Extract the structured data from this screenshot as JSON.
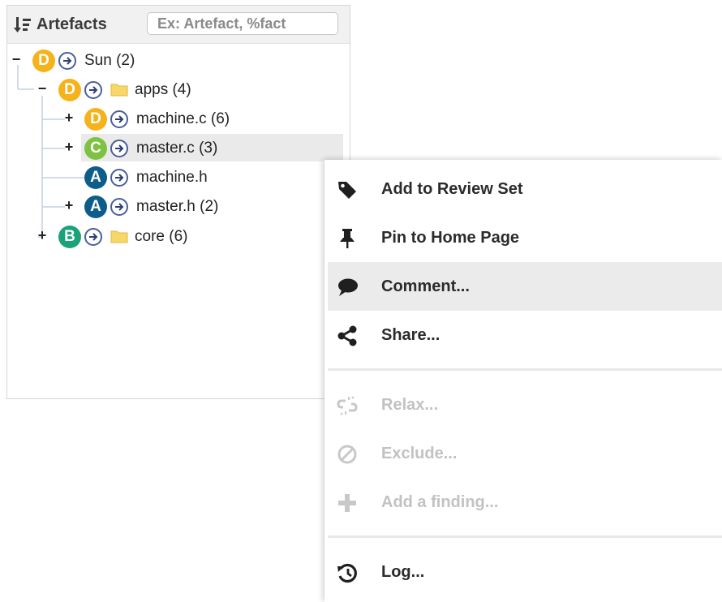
{
  "panel": {
    "title": "Artefacts",
    "sort_icon": "sort-descending-icon",
    "search": {
      "placeholder": "Ex: Artefact, %fact",
      "value": ""
    }
  },
  "tree": [
    {
      "label": "Sun (2)",
      "grade": "D",
      "toggle": "−",
      "folder": false
    },
    {
      "label": "apps (4)",
      "grade": "D",
      "toggle": "−",
      "folder": true
    },
    {
      "label": "machine.c (6)",
      "grade": "D",
      "toggle": "+",
      "folder": false
    },
    {
      "label": "master.c (3)",
      "grade": "C",
      "toggle": "+",
      "folder": false,
      "selected": true
    },
    {
      "label": "machine.h",
      "grade": "A",
      "toggle": "",
      "folder": false
    },
    {
      "label": "master.h (2)",
      "grade": "A",
      "toggle": "+",
      "folder": false
    },
    {
      "label": "core (6)",
      "grade": "B",
      "toggle": "+",
      "folder": true
    }
  ],
  "grade_colors": {
    "A": "#0d5d8a",
    "B": "#1aa37a",
    "C": "#7ec242",
    "D": "#f6b21b"
  },
  "context_menu": {
    "items": [
      {
        "label": "Add to Review Set",
        "icon": "tag-icon",
        "enabled": true
      },
      {
        "label": "Pin to Home Page",
        "icon": "pin-icon",
        "enabled": true
      },
      {
        "label": "Comment...",
        "icon": "comment-icon",
        "enabled": true,
        "hovered": true
      },
      {
        "label": "Share...",
        "icon": "share-icon",
        "enabled": true
      },
      {
        "label": "Relax...",
        "icon": "broken-link-icon",
        "enabled": false
      },
      {
        "label": "Exclude...",
        "icon": "exclude-icon",
        "enabled": false
      },
      {
        "label": "Add a finding...",
        "icon": "plus-icon",
        "enabled": false
      },
      {
        "label": "Log...",
        "icon": "history-icon",
        "enabled": true
      }
    ]
  }
}
